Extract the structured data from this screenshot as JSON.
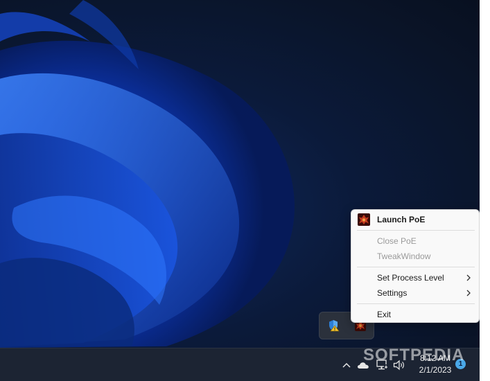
{
  "context_menu": {
    "items": [
      {
        "label": "Launch PoE",
        "enabled": true,
        "bold": true,
        "icon": "poe-logo-icon"
      },
      {
        "label": "Close PoE",
        "enabled": false
      },
      {
        "label": "TweakWindow",
        "enabled": false
      },
      {
        "label": "Set Process Level",
        "enabled": true,
        "has_submenu": true
      },
      {
        "label": "Settings",
        "enabled": true,
        "has_submenu": true
      },
      {
        "label": "Exit",
        "enabled": true
      }
    ]
  },
  "overflow_flyout": {
    "icons": [
      "windows-security-warning-icon",
      "poe-tray-icon"
    ]
  },
  "taskbar": {
    "tray_icons": [
      "chevron-up-icon",
      "onedrive-cloud-icon",
      "network-icon",
      "volume-icon"
    ],
    "clock": {
      "time": "8:12 AM",
      "date": "2/1/2023"
    },
    "notification_count": "1"
  },
  "watermark": "SOFTPEDIA",
  "colors": {
    "accent": "#4aa8e8",
    "taskbar": "#1c2433",
    "menu_bg": "#f9f9f9",
    "disabled_text": "#9a9a9a",
    "poe_icon": "#8b1e12"
  }
}
